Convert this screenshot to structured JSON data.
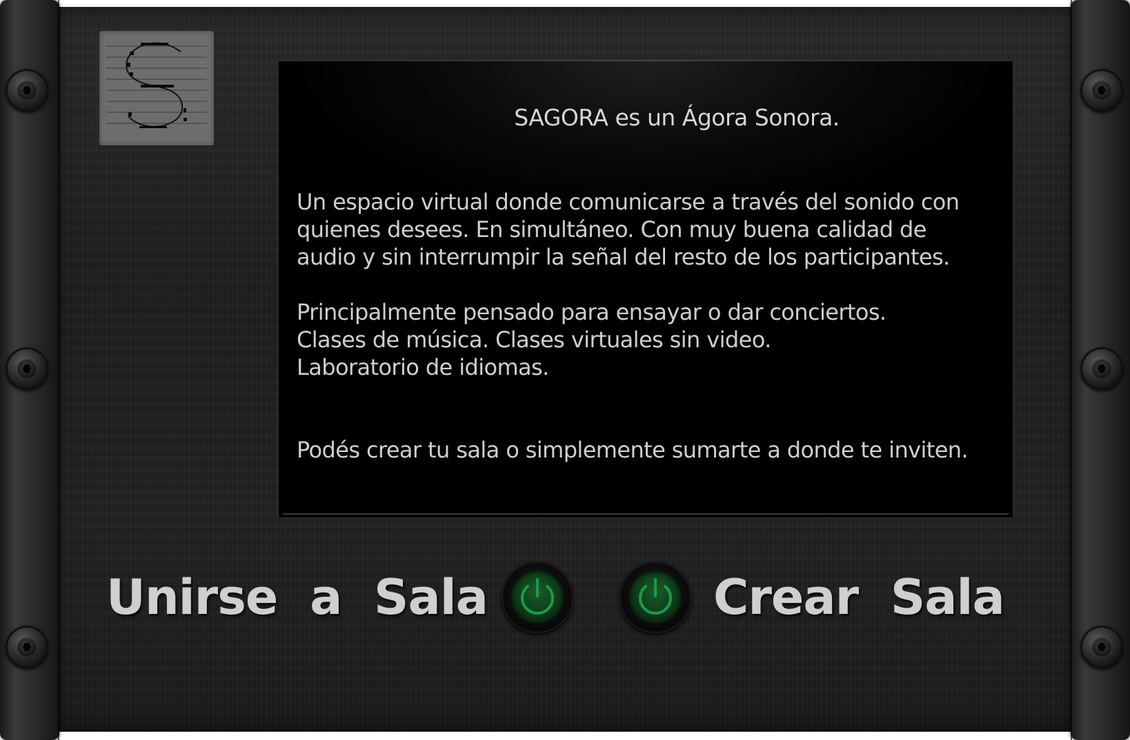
{
  "app": {
    "logo_icon": "sagora-logo-icon",
    "accent_color": "#1f7a3a"
  },
  "screen": {
    "title": "SAGORA es un Ágora Sonora.",
    "intro_lines": [
      "Un espacio virtual donde comunicarse a través del sonido con",
      "quienes desees.  En simultáneo.  Con muy buena calidad de",
      "audio y sin interrumpir la señal del resto de los participantes."
    ],
    "uses_lines": [
      "Principalmente pensado para ensayar o dar conciertos.",
      "Clases de música. Clases virtuales sin video.",
      "Laboratorio de idiomas."
    ],
    "cta_line": "Podés crear tu sala o simplemente sumarte a donde te inviten."
  },
  "actions": {
    "join": {
      "label": "Unirse  a  Sala",
      "icon": "power-icon"
    },
    "create": {
      "label": "Crear  Sala",
      "icon": "power-icon"
    }
  }
}
